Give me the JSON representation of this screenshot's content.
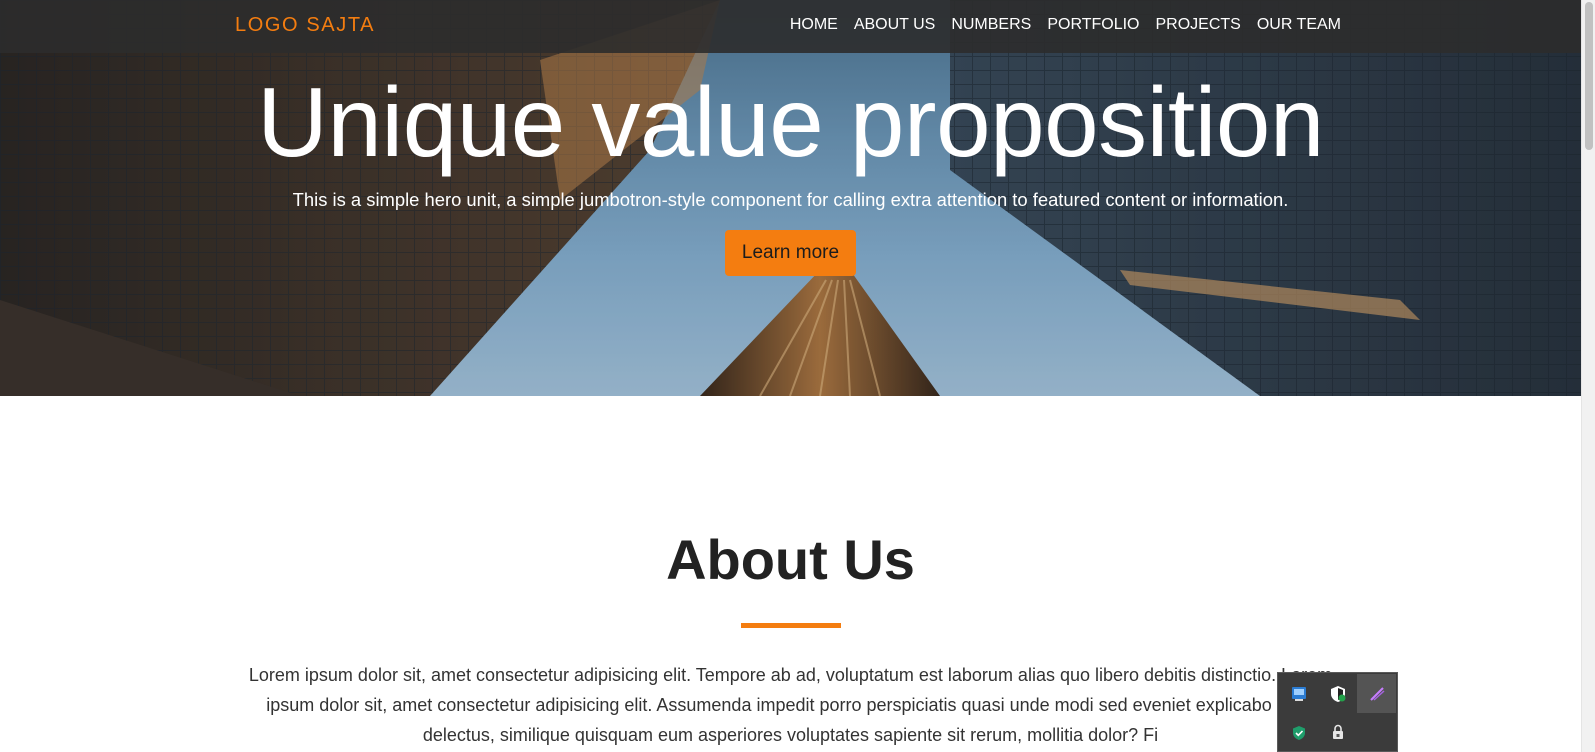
{
  "navbar": {
    "logo": "LOGO SAJTA",
    "items": [
      "HOME",
      "ABOUT US",
      "NUMBERS",
      "PORTFOLIO",
      "PROJECTS",
      "OUR TEAM"
    ]
  },
  "hero": {
    "title": "Unique value proposition",
    "subtitle": "This is a simple hero unit, a simple jumbotron-style component for calling extra attention to featured content or information.",
    "button": "Learn more"
  },
  "about": {
    "title": "About Us",
    "text": "Lorem ipsum dolor sit, amet consectetur adipisicing elit. Tempore ab ad, voluptatum est laborum alias quo libero debitis distinctio. Lorem ipsum dolor sit, amet consectetur adipisicing elit. Assumenda impedit porro perspiciatis quasi unde modi sed eveniet explicabo iusto delectus, similique quisquam eum asperiores voluptates sapiente sit rerum, mollitia dolor? Fi"
  },
  "tray": {
    "icons": [
      "network-drive-icon",
      "shield-icon",
      "feather-pen-icon",
      "security-check-icon",
      "printer-lock-icon"
    ]
  },
  "colors": {
    "accent": "#f47d10",
    "navbar_bg": "#2c2c2c",
    "heading_text": "#222222",
    "body_text": "#333333"
  }
}
